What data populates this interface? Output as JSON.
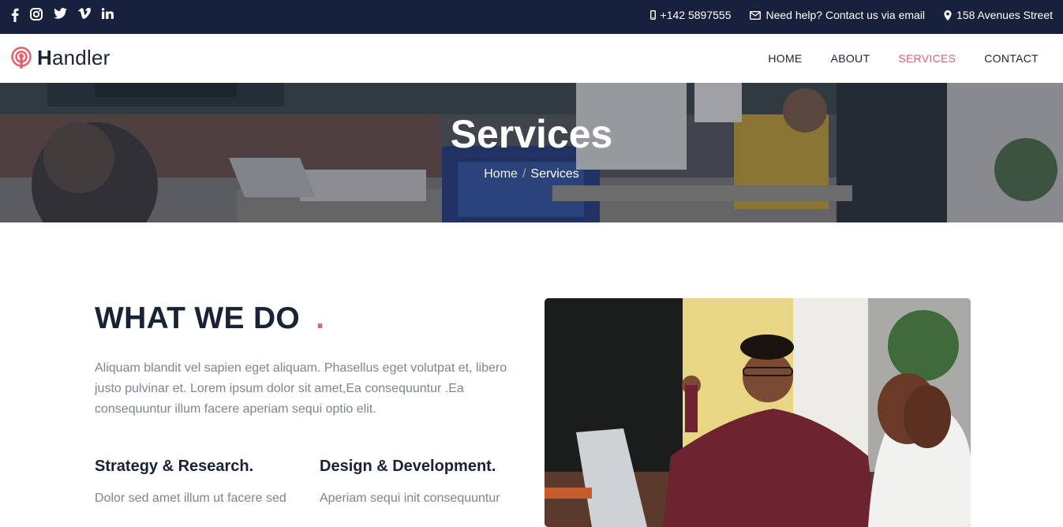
{
  "topbar": {
    "phone": "+142 5897555",
    "help": "Need help? Contact us via email",
    "address": "158 Avenues Street",
    "social_icons": [
      "facebook-icon",
      "instagram-icon",
      "twitter-icon",
      "vimeo-icon",
      "linkedin-icon"
    ]
  },
  "brand": {
    "first_letter": "H",
    "rest": "andler"
  },
  "nav": {
    "home": "HOME",
    "about": "ABOUT",
    "services": "SERVICES",
    "contact": "CONTACT"
  },
  "hero": {
    "title": "Services",
    "breadcrumb": {
      "home": "Home",
      "separator": "/",
      "current": "Services"
    }
  },
  "section": {
    "heading": "WHAT WE DO",
    "heading_dot": ".",
    "paragraph": "Aliquam blandit vel sapien eget aliquam. Phasellus eget volutpat et, libero justo pulvinar et. Lorem ipsum dolor sit amet,Ea consequuntur .Ea consequuntur illum facere aperiam sequi optio elit.",
    "col1_title": "Strategy & Research.",
    "col1_text": "Dolor sed amet illum ut facere sed",
    "col2_title": "Design & Development.",
    "col2_text": "Aperiam sequi init consequuntur"
  },
  "colors": {
    "navy": "#17213d",
    "accent": "#e8606a",
    "text_dark": "#1a2236",
    "text_muted": "#7c8595"
  }
}
